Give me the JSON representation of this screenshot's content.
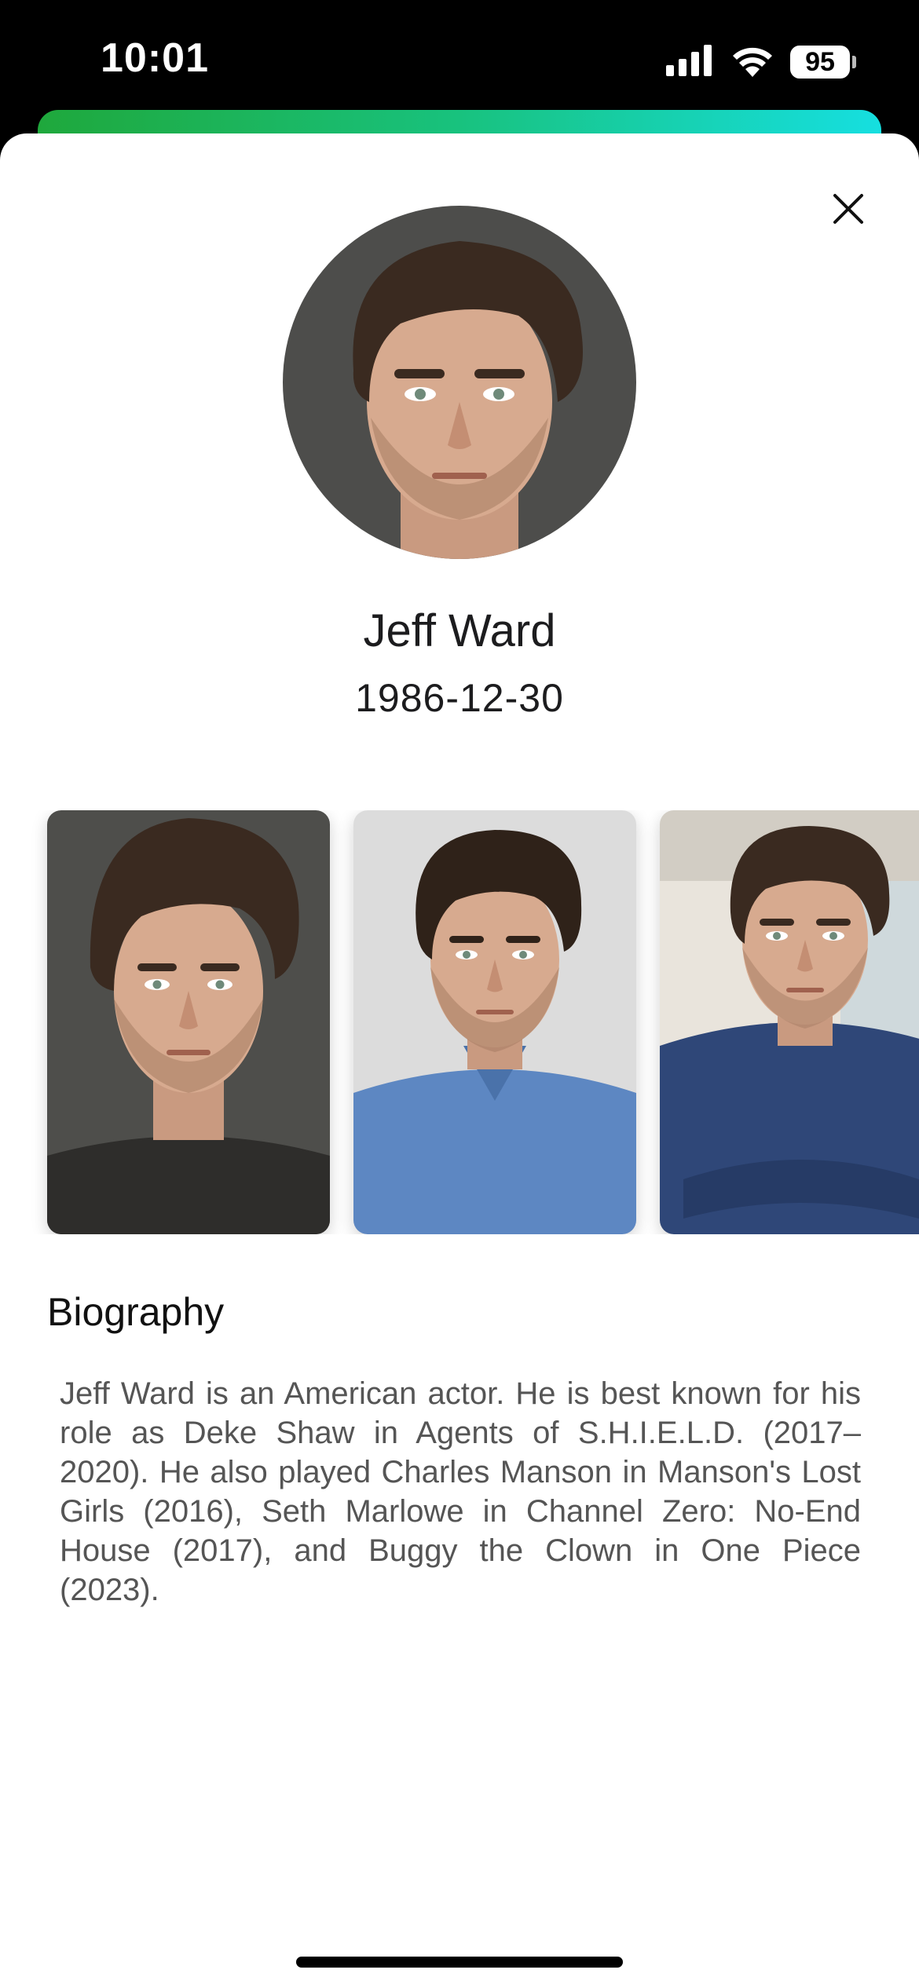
{
  "status_bar": {
    "time": "10:01",
    "battery_level": "95",
    "icons": [
      "cellular-signal-icon",
      "wifi-icon",
      "battery-icon"
    ]
  },
  "theme": {
    "gradient_start": "#1fa83c",
    "gradient_end": "#16dfe0",
    "text_primary": "#1c1c1e",
    "text_secondary": "#555555"
  },
  "profile": {
    "name": "Jeff Ward",
    "birth_date": "1986-12-30",
    "avatar_icon": "portrait-photo"
  },
  "gallery": {
    "photos": [
      {
        "alt": "Portrait on dark gray background"
      },
      {
        "alt": "Portrait in blue denim shirt"
      },
      {
        "alt": "Portrait in navy jacket with arms crossed"
      }
    ]
  },
  "biography": {
    "heading": "Biography",
    "text": "Jeff Ward is an American actor. He is best known for his role as Deke Shaw in Agents of S.H.I.E.L.D. (2017–2020). He also played Charles Manson in Manson's Lost Girls (2016), Seth Marlowe in Channel Zero: No-End House (2017), and Buggy the Clown in One Piece (2023)."
  }
}
